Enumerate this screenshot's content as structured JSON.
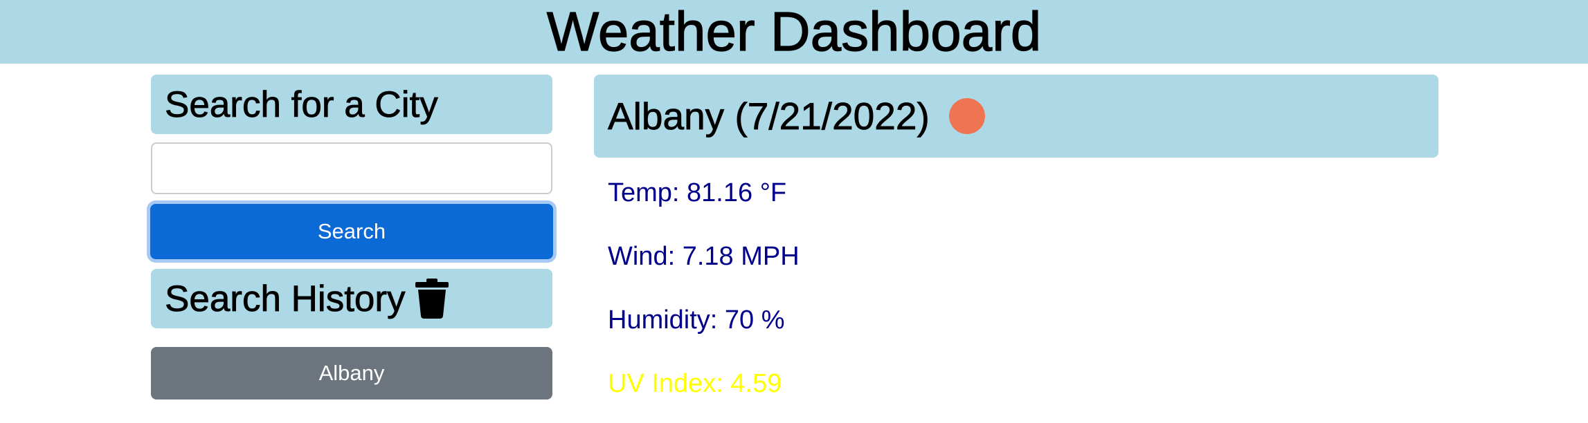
{
  "header": {
    "title": "Weather Dashboard"
  },
  "search": {
    "title": "Search for a City",
    "input_value": "",
    "button_label": "Search"
  },
  "history": {
    "title": "Search History",
    "items": [
      "Albany"
    ],
    "clear_icon": "trash-icon"
  },
  "current": {
    "title": "Albany (7/21/2022)",
    "icon": "sun-icon",
    "temp": "Temp: 81.16 °F",
    "wind": "Wind: 7.18 MPH",
    "humidity": "Humidity: 70 %",
    "uv": "UV Index: 4.59"
  },
  "colors": {
    "header_bg": "#add8e6",
    "primary": "#0b6ad6",
    "secondary": "#6c757d",
    "stat_text": "#00008b",
    "uv_text": "#ffff00",
    "weather_icon": "#ef7451"
  }
}
